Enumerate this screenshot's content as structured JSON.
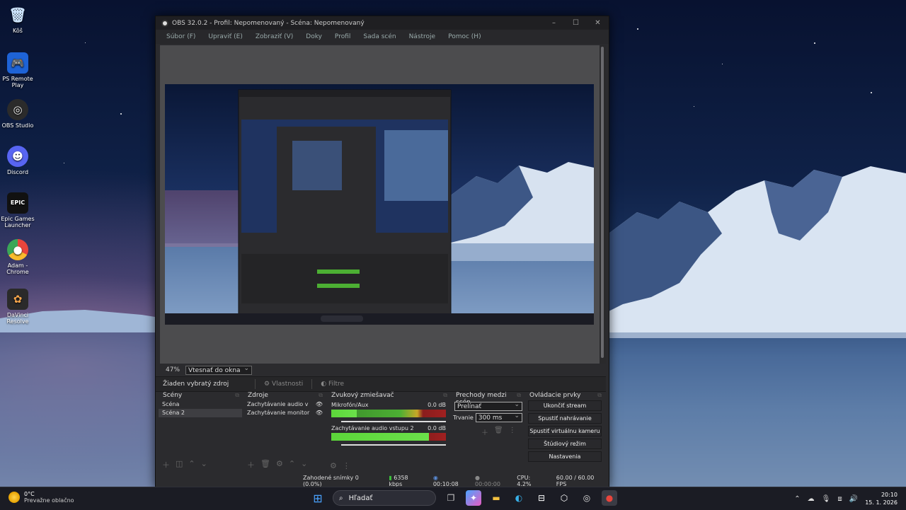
{
  "desktop": {
    "icons": [
      {
        "label": "Kôš",
        "icon": "recycle-bin-icon",
        "color": "#9ecfff"
      },
      {
        "label": "PS Remote Play",
        "icon": "ps-remote-play-icon",
        "color": "#1e63d6"
      },
      {
        "label": "OBS Studio",
        "icon": "obs-studio-icon",
        "color": "#333333"
      },
      {
        "label": "Discord",
        "icon": "discord-icon",
        "color": "#5865F2"
      },
      {
        "label": "Epic Games Launcher",
        "icon": "epic-games-icon",
        "color": "#111111"
      },
      {
        "label": "Adam - Chrome",
        "icon": "chrome-icon",
        "color": "#e8453c"
      },
      {
        "label": "DaVinci Resolve",
        "icon": "davinci-resolve-icon",
        "color": "#2a2a2a"
      }
    ]
  },
  "obs": {
    "title": "OBS 32.0.2 - Profil: Nepomenovaný - Scéna: Nepomenovaný",
    "window_controls": {
      "minimize": "–",
      "maximize": "☐",
      "close": "✕"
    },
    "menu": [
      "Súbor (F)",
      "Upraviť (E)",
      "Zobraziť (V)",
      "Doky",
      "Profil",
      "Sada scén",
      "Nástroje",
      "Pomoc (H)"
    ],
    "zoom": "47%",
    "zoom_mode": "Vtesnať do okna",
    "no_source": "Žiaden vybratý zdroj",
    "properties_tab": "Vlastnosti",
    "filters_tab": "Filtre",
    "scenes": {
      "title": "Scény",
      "items": [
        "Scéna",
        "Scéna 2"
      ],
      "selected_index": 1
    },
    "sources": {
      "title": "Zdroje",
      "items": [
        "Zachytávanie audio v",
        "Zachytávanie monitor"
      ]
    },
    "mixer": {
      "title": "Zvukový zmiešavač",
      "channels": [
        {
          "name": "Mikrofón/Aux",
          "db": "0.0 dB",
          "level": 0.22
        },
        {
          "name": "Zachytávanie audio vstupu 2",
          "db": "0.0 dB",
          "level": 0.85
        }
      ]
    },
    "transitions": {
      "title": "Prechody medzi scén...",
      "type": "Prelínať",
      "duration_label": "Trvanie",
      "duration": "300 ms"
    },
    "controls": {
      "title": "Ovládacie prvky",
      "buttons": [
        "Ukončiť stream",
        "Spustiť nahrávanie",
        "Spustiť virtuálnu kameru",
        "Štúdiový režim",
        "Nastavenia"
      ]
    },
    "status": {
      "dropped": "Zahodené snímky 0 (0.0%)",
      "bitrate": "6358 kbps",
      "stream_time": "00:10:08",
      "rec_time": "00:00:00",
      "cpu": "CPU: 4.2%",
      "fps": "60.00 / 60.00 FPS"
    }
  },
  "taskbar": {
    "weather_temp": "0°C",
    "weather_desc": "Prevažne oblačno",
    "search_placeholder": "Hľadať",
    "time": "20:10",
    "date": "15. 1. 2026"
  }
}
